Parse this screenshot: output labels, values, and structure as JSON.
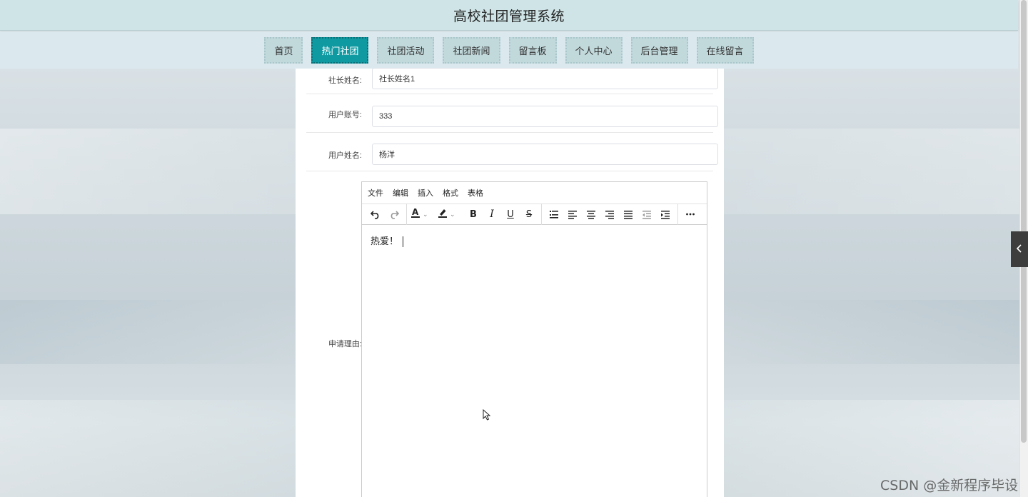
{
  "header": {
    "title": "高校社团管理系统"
  },
  "nav": {
    "items": [
      {
        "label": "首页",
        "active": false
      },
      {
        "label": "热门社团",
        "active": true
      },
      {
        "label": "社团活动",
        "active": false
      },
      {
        "label": "社团新闻",
        "active": false
      },
      {
        "label": "留言板",
        "active": false
      },
      {
        "label": "个人中心",
        "active": false
      },
      {
        "label": "后台管理",
        "active": false
      },
      {
        "label": "在线留言",
        "active": false
      }
    ]
  },
  "form": {
    "leader_name": {
      "label": "社长姓名:",
      "value": "社长姓名1"
    },
    "user_account": {
      "label": "用户账号:",
      "value": "333"
    },
    "user_name": {
      "label": "用户姓名:",
      "value": "杨洋"
    },
    "reason": {
      "label": "申请理由:"
    }
  },
  "editor": {
    "menu": [
      "文件",
      "编辑",
      "插入",
      "格式",
      "表格"
    ],
    "content": "热爱！"
  },
  "watermark": "CSDN @金新程序毕设",
  "colors": {
    "accent": "#0f9aa2",
    "header_bg": "#cfe4e6",
    "nav_bg": "#dbe9ef"
  }
}
